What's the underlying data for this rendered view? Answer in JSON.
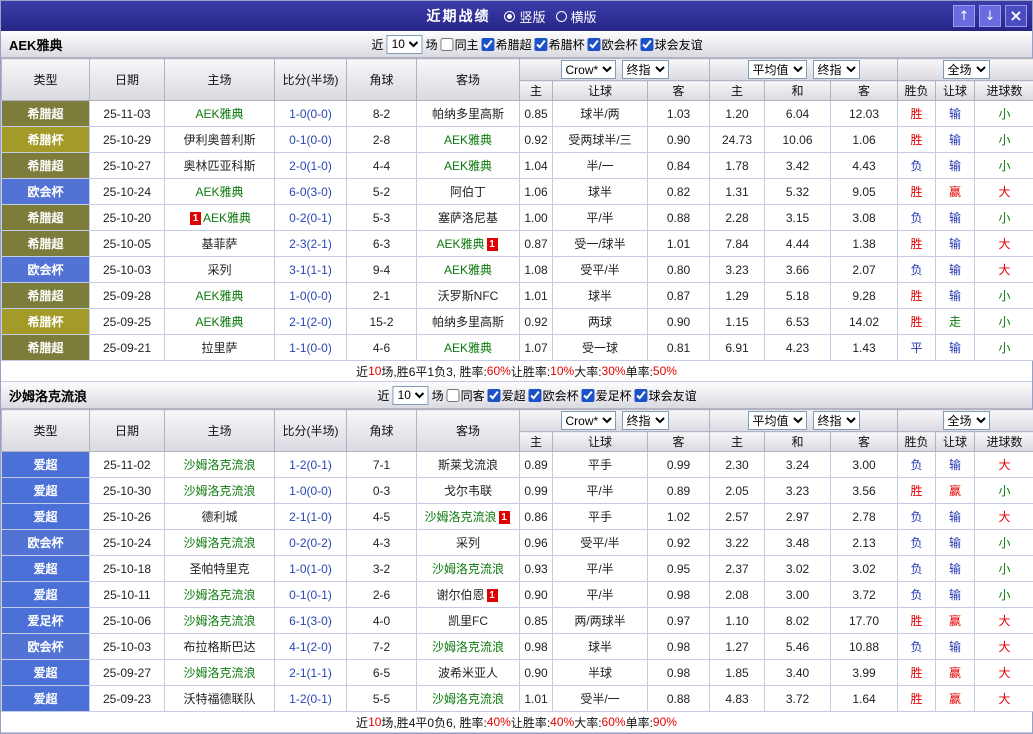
{
  "titlebar": {
    "title": "近期战绩",
    "radios": [
      {
        "label": "竖版",
        "selected": true
      },
      {
        "label": "横版",
        "selected": false
      }
    ],
    "up": "↑",
    "down": "↓",
    "close": "×"
  },
  "colors": {
    "comp": {
      "希腊超": "#7d7d3b",
      "希腊杯": "#a39a28",
      "欧会杯": "#5273d3",
      "爱超": "#4b70d8",
      "爱足杯": "#4b70d8"
    }
  },
  "table_header": {
    "cols": [
      "类型",
      "日期",
      "主场",
      "比分(半场)",
      "角球",
      "客场"
    ],
    "asia_selects": [
      "Crow*",
      "终指"
    ],
    "asia_sub": [
      "主",
      "让球",
      "客"
    ],
    "europe_selects": [
      "平均值",
      "终指"
    ],
    "europe_sub": [
      "主",
      "和",
      "客"
    ],
    "result_select": "全场",
    "result_sub": [
      "胜负",
      "让球",
      "进球数"
    ]
  },
  "sections": [
    {
      "team": "AEK雅典",
      "filter": {
        "near": "近",
        "count": "10",
        "games": "场",
        "same": "同主",
        "same_checked": false,
        "comps": [
          {
            "label": "希腊超",
            "checked": true
          },
          {
            "label": "希腊杯",
            "checked": true
          },
          {
            "label": "欧会杯",
            "checked": true
          },
          {
            "label": "球会友谊",
            "checked": true
          }
        ]
      },
      "rows": [
        {
          "comp": "希腊超",
          "date": "25-11-03",
          "home": "AEK雅典",
          "homeHL": true,
          "homeCardPre": "",
          "homeCardPost": "",
          "score": "1-0(0-0)",
          "corner": "8-2",
          "away": "帕纳多里高斯",
          "awayHL": false,
          "awayCardPost": "",
          "o": [
            "0.85",
            "球半/两",
            "1.03"
          ],
          "e": [
            "1.20",
            "6.04",
            "12.03"
          ],
          "r": [
            [
              "胜",
              "r"
            ],
            [
              "输",
              "b"
            ],
            [
              "小",
              "g"
            ]
          ]
        },
        {
          "comp": "希腊杯",
          "date": "25-10-29",
          "home": "伊利奥普利斯",
          "homeHL": false,
          "homeCardPre": "",
          "homeCardPost": "",
          "score": "0-1(0-0)",
          "corner": "2-8",
          "away": "AEK雅典",
          "awayHL": true,
          "awayCardPost": "",
          "o": [
            "0.92",
            "受两球半/三",
            "0.90"
          ],
          "e": [
            "24.73",
            "10.06",
            "1.06"
          ],
          "r": [
            [
              "胜",
              "r"
            ],
            [
              "输",
              "b"
            ],
            [
              "小",
              "g"
            ]
          ]
        },
        {
          "comp": "希腊超",
          "date": "25-10-27",
          "home": "奥林匹亚科斯",
          "homeHL": false,
          "homeCardPre": "",
          "homeCardPost": "",
          "score": "2-0(1-0)",
          "corner": "4-4",
          "away": "AEK雅典",
          "awayHL": true,
          "awayCardPost": "",
          "o": [
            "1.04",
            "半/一",
            "0.84"
          ],
          "e": [
            "1.78",
            "3.42",
            "4.43"
          ],
          "r": [
            [
              "负",
              "b"
            ],
            [
              "输",
              "b"
            ],
            [
              "小",
              "g"
            ]
          ]
        },
        {
          "comp": "欧会杯",
          "date": "25-10-24",
          "home": "AEK雅典",
          "homeHL": true,
          "homeCardPre": "",
          "homeCardPost": "",
          "score": "6-0(3-0)",
          "corner": "5-2",
          "away": "阿伯丁",
          "awayHL": false,
          "awayCardPost": "",
          "o": [
            "1.06",
            "球半",
            "0.82"
          ],
          "e": [
            "1.31",
            "5.32",
            "9.05"
          ],
          "r": [
            [
              "胜",
              "r"
            ],
            [
              "赢",
              "r"
            ],
            [
              "大",
              "r"
            ]
          ]
        },
        {
          "comp": "希腊超",
          "date": "25-10-20",
          "home": "AEK雅典",
          "homeHL": true,
          "homeCardPre": "1",
          "homeCardPost": "",
          "score": "0-2(0-1)",
          "corner": "5-3",
          "away": "塞萨洛尼基",
          "awayHL": false,
          "awayCardPost": "",
          "o": [
            "1.00",
            "平/半",
            "0.88"
          ],
          "e": [
            "2.28",
            "3.15",
            "3.08"
          ],
          "r": [
            [
              "负",
              "b"
            ],
            [
              "输",
              "b"
            ],
            [
              "小",
              "g"
            ]
          ]
        },
        {
          "comp": "希腊超",
          "date": "25-10-05",
          "home": "基菲萨",
          "homeHL": false,
          "homeCardPre": "",
          "homeCardPost": "",
          "score": "2-3(2-1)",
          "corner": "6-3",
          "away": "AEK雅典",
          "awayHL": true,
          "awayCardPost": "1",
          "o": [
            "0.87",
            "受一/球半",
            "1.01"
          ],
          "e": [
            "7.84",
            "4.44",
            "1.38"
          ],
          "r": [
            [
              "胜",
              "r"
            ],
            [
              "输",
              "b"
            ],
            [
              "大",
              "r"
            ]
          ]
        },
        {
          "comp": "欧会杯",
          "date": "25-10-03",
          "home": "采列",
          "homeHL": false,
          "homeCardPre": "",
          "homeCardPost": "",
          "score": "3-1(1-1)",
          "corner": "9-4",
          "away": "AEK雅典",
          "awayHL": true,
          "awayCardPost": "",
          "o": [
            "1.08",
            "受平/半",
            "0.80"
          ],
          "e": [
            "3.23",
            "3.66",
            "2.07"
          ],
          "r": [
            [
              "负",
              "b"
            ],
            [
              "输",
              "b"
            ],
            [
              "大",
              "r"
            ]
          ]
        },
        {
          "comp": "希腊超",
          "date": "25-09-28",
          "home": "AEK雅典",
          "homeHL": true,
          "homeCardPre": "",
          "homeCardPost": "",
          "score": "1-0(0-0)",
          "corner": "2-1",
          "away": "沃罗斯NFC",
          "awayHL": false,
          "awayCardPost": "",
          "o": [
            "1.01",
            "球半",
            "0.87"
          ],
          "e": [
            "1.29",
            "5.18",
            "9.28"
          ],
          "r": [
            [
              "胜",
              "r"
            ],
            [
              "输",
              "b"
            ],
            [
              "小",
              "g"
            ]
          ]
        },
        {
          "comp": "希腊杯",
          "date": "25-09-25",
          "home": "AEK雅典",
          "homeHL": true,
          "homeCardPre": "",
          "homeCardPost": "",
          "score": "2-1(2-0)",
          "corner": "15-2",
          "away": "帕纳多里高斯",
          "awayHL": false,
          "awayCardPost": "",
          "o": [
            "0.92",
            "两球",
            "0.90"
          ],
          "e": [
            "1.15",
            "6.53",
            "14.02"
          ],
          "r": [
            [
              "胜",
              "r"
            ],
            [
              "走",
              "g"
            ],
            [
              "小",
              "g"
            ]
          ]
        },
        {
          "comp": "希腊超",
          "date": "25-09-21",
          "home": "拉里萨",
          "homeHL": false,
          "homeCardPre": "",
          "homeCardPost": "",
          "score": "1-1(0-0)",
          "corner": "4-6",
          "away": "AEK雅典",
          "awayHL": true,
          "awayCardPost": "",
          "o": [
            "1.07",
            "受一球",
            "0.81"
          ],
          "e": [
            "6.91",
            "4.23",
            "1.43"
          ],
          "r": [
            [
              "平",
              "b"
            ],
            [
              "输",
              "b"
            ],
            [
              "小",
              "g"
            ]
          ]
        }
      ],
      "summary": [
        [
          "近",
          "k"
        ],
        [
          "10",
          "r"
        ],
        [
          "场,胜6平1负3, 胜率:",
          "k"
        ],
        [
          "60%",
          "r"
        ],
        [
          " 让胜率:",
          "k"
        ],
        [
          "10%",
          "r"
        ],
        [
          " 大率:",
          "k"
        ],
        [
          "30%",
          "r"
        ],
        [
          " 单率:",
          "k"
        ],
        [
          "50%",
          "r"
        ]
      ]
    },
    {
      "team": "沙姆洛克流浪",
      "filter": {
        "near": "近",
        "count": "10",
        "games": "场",
        "same": "同客",
        "same_checked": false,
        "comps": [
          {
            "label": "爱超",
            "checked": true
          },
          {
            "label": "欧会杯",
            "checked": true
          },
          {
            "label": "爱足杯",
            "checked": true
          },
          {
            "label": "球会友谊",
            "checked": true
          }
        ]
      },
      "rows": [
        {
          "comp": "爱超",
          "date": "25-11-02",
          "home": "沙姆洛克流浪",
          "homeHL": true,
          "homeCardPre": "",
          "homeCardPost": "",
          "score": "1-2(0-1)",
          "corner": "7-1",
          "away": "斯莱戈流浪",
          "awayHL": false,
          "awayCardPost": "",
          "o": [
            "0.89",
            "平手",
            "0.99"
          ],
          "e": [
            "2.30",
            "3.24",
            "3.00"
          ],
          "r": [
            [
              "负",
              "b"
            ],
            [
              "输",
              "b"
            ],
            [
              "大",
              "r"
            ]
          ]
        },
        {
          "comp": "爱超",
          "date": "25-10-30",
          "home": "沙姆洛克流浪",
          "homeHL": true,
          "homeCardPre": "",
          "homeCardPost": "",
          "score": "1-0(0-0)",
          "corner": "0-3",
          "away": "戈尔韦联",
          "awayHL": false,
          "awayCardPost": "",
          "o": [
            "0.99",
            "平/半",
            "0.89"
          ],
          "e": [
            "2.05",
            "3.23",
            "3.56"
          ],
          "r": [
            [
              "胜",
              "r"
            ],
            [
              "赢",
              "r"
            ],
            [
              "小",
              "g"
            ]
          ]
        },
        {
          "comp": "爱超",
          "date": "25-10-26",
          "home": "德利城",
          "homeHL": false,
          "homeCardPre": "",
          "homeCardPost": "",
          "score": "2-1(1-0)",
          "corner": "4-5",
          "away": "沙姆洛克流浪",
          "awayHL": true,
          "awayCardPost": "1",
          "o": [
            "0.86",
            "平手",
            "1.02"
          ],
          "e": [
            "2.57",
            "2.97",
            "2.78"
          ],
          "r": [
            [
              "负",
              "b"
            ],
            [
              "输",
              "b"
            ],
            [
              "大",
              "r"
            ]
          ]
        },
        {
          "comp": "欧会杯",
          "date": "25-10-24",
          "home": "沙姆洛克流浪",
          "homeHL": true,
          "homeCardPre": "",
          "homeCardPost": "",
          "score": "0-2(0-2)",
          "corner": "4-3",
          "away": "采列",
          "awayHL": false,
          "awayCardPost": "",
          "o": [
            "0.96",
            "受平/半",
            "0.92"
          ],
          "e": [
            "3.22",
            "3.48",
            "2.13"
          ],
          "r": [
            [
              "负",
              "b"
            ],
            [
              "输",
              "b"
            ],
            [
              "小",
              "g"
            ]
          ]
        },
        {
          "comp": "爱超",
          "date": "25-10-18",
          "home": "圣帕特里克",
          "homeHL": false,
          "homeCardPre": "",
          "homeCardPost": "",
          "score": "1-0(1-0)",
          "corner": "3-2",
          "away": "沙姆洛克流浪",
          "awayHL": true,
          "awayCardPost": "",
          "o": [
            "0.93",
            "平/半",
            "0.95"
          ],
          "e": [
            "2.37",
            "3.02",
            "3.02"
          ],
          "r": [
            [
              "负",
              "b"
            ],
            [
              "输",
              "b"
            ],
            [
              "小",
              "g"
            ]
          ]
        },
        {
          "comp": "爱超",
          "date": "25-10-11",
          "home": "沙姆洛克流浪",
          "homeHL": true,
          "homeCardPre": "",
          "homeCardPost": "",
          "score": "0-1(0-1)",
          "corner": "2-6",
          "away": "谢尔伯恩",
          "awayHL": false,
          "awayCardPost": "1",
          "o": [
            "0.90",
            "平/半",
            "0.98"
          ],
          "e": [
            "2.08",
            "3.00",
            "3.72"
          ],
          "r": [
            [
              "负",
              "b"
            ],
            [
              "输",
              "b"
            ],
            [
              "小",
              "g"
            ]
          ]
        },
        {
          "comp": "爱足杯",
          "date": "25-10-06",
          "home": "沙姆洛克流浪",
          "homeHL": true,
          "homeCardPre": "",
          "homeCardPost": "",
          "score": "6-1(3-0)",
          "corner": "4-0",
          "away": "凯里FC",
          "awayHL": false,
          "awayCardPost": "",
          "o": [
            "0.85",
            "两/两球半",
            "0.97"
          ],
          "e": [
            "1.10",
            "8.02",
            "17.70"
          ],
          "r": [
            [
              "胜",
              "r"
            ],
            [
              "赢",
              "r"
            ],
            [
              "大",
              "r"
            ]
          ]
        },
        {
          "comp": "欧会杯",
          "date": "25-10-03",
          "home": "布拉格斯巴达",
          "homeHL": false,
          "homeCardPre": "",
          "homeCardPost": "",
          "score": "4-1(2-0)",
          "corner": "7-2",
          "away": "沙姆洛克流浪",
          "awayHL": true,
          "awayCardPost": "",
          "o": [
            "0.98",
            "球半",
            "0.98"
          ],
          "e": [
            "1.27",
            "5.46",
            "10.88"
          ],
          "r": [
            [
              "负",
              "b"
            ],
            [
              "输",
              "b"
            ],
            [
              "大",
              "r"
            ]
          ]
        },
        {
          "comp": "爱超",
          "date": "25-09-27",
          "home": "沙姆洛克流浪",
          "homeHL": true,
          "homeCardPre": "",
          "homeCardPost": "",
          "score": "2-1(1-1)",
          "corner": "6-5",
          "away": "波希米亚人",
          "awayHL": false,
          "awayCardPost": "",
          "o": [
            "0.90",
            "半球",
            "0.98"
          ],
          "e": [
            "1.85",
            "3.40",
            "3.99"
          ],
          "r": [
            [
              "胜",
              "r"
            ],
            [
              "赢",
              "r"
            ],
            [
              "大",
              "r"
            ]
          ]
        },
        {
          "comp": "爱超",
          "date": "25-09-23",
          "home": "沃特福德联队",
          "homeHL": false,
          "homeCardPre": "",
          "homeCardPost": "",
          "score": "1-2(0-1)",
          "corner": "5-5",
          "away": "沙姆洛克流浪",
          "awayHL": true,
          "awayCardPost": "",
          "o": [
            "1.01",
            "受半/一",
            "0.88"
          ],
          "e": [
            "4.83",
            "3.72",
            "1.64"
          ],
          "r": [
            [
              "胜",
              "r"
            ],
            [
              "赢",
              "r"
            ],
            [
              "大",
              "r"
            ]
          ]
        }
      ],
      "summary": [
        [
          "近",
          "k"
        ],
        [
          "10",
          "r"
        ],
        [
          "场,胜4平0负6, 胜率:",
          "k"
        ],
        [
          "40%",
          "r"
        ],
        [
          " 让胜率:",
          "k"
        ],
        [
          "40%",
          "r"
        ],
        [
          " 大率:",
          "k"
        ],
        [
          "60%",
          "r"
        ],
        [
          " 单率:",
          "k"
        ],
        [
          "90%",
          "r"
        ]
      ]
    }
  ]
}
